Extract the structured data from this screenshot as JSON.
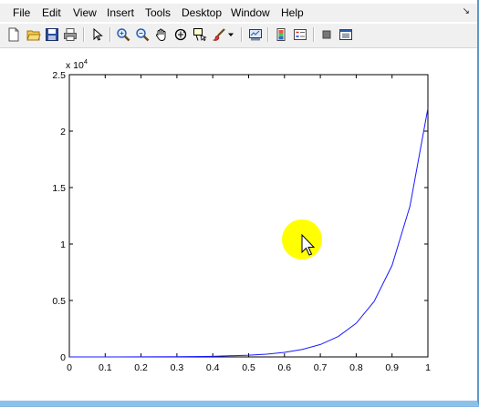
{
  "menubar": {
    "items": [
      "File",
      "Edit",
      "View",
      "Insert",
      "Tools",
      "Desktop",
      "Window",
      "Help"
    ],
    "dock_glyph": "↘"
  },
  "toolbar": {
    "buttons": [
      {
        "name": "new-figure-icon"
      },
      {
        "name": "open-file-icon"
      },
      {
        "name": "save-figure-icon"
      },
      {
        "name": "print-figure-icon"
      },
      {
        "name": "edit-plot-arrow-icon"
      },
      {
        "name": "zoom-in-icon"
      },
      {
        "name": "zoom-out-icon"
      },
      {
        "name": "pan-hand-icon"
      },
      {
        "name": "rotate-3d-icon"
      },
      {
        "name": "data-cursor-icon"
      },
      {
        "name": "brush-icon"
      },
      {
        "name": "brush-dropdown-icon"
      },
      {
        "name": "link-plot-icon"
      },
      {
        "name": "insert-colorbar-icon"
      },
      {
        "name": "insert-legend-icon"
      },
      {
        "name": "hide-plot-tools-icon"
      },
      {
        "name": "show-plot-tools-icon"
      }
    ]
  },
  "chart_data": {
    "type": "line",
    "exponent_label": "x 10",
    "exponent_power": "4",
    "x": [
      0,
      0.1,
      0.2,
      0.3,
      0.4,
      0.5,
      0.55,
      0.6,
      0.65,
      0.7,
      0.75,
      0.8,
      0.85,
      0.9,
      0.95,
      1.0
    ],
    "y": [
      1,
      2.7,
      7.4,
      20.1,
      54.6,
      148,
      245,
      403,
      665,
      1097,
      1808,
      2981,
      4915,
      8103,
      13360,
      22026
    ],
    "xlim": [
      0,
      1
    ],
    "ylim": [
      0,
      25000
    ],
    "xticks": [
      "0",
      "0.1",
      "0.2",
      "0.3",
      "0.4",
      "0.5",
      "0.6",
      "0.7",
      "0.8",
      "0.9",
      "1"
    ],
    "yticks": [
      "0",
      "0.5",
      "1",
      "1.5",
      "2",
      "2.5"
    ],
    "ytick_values": [
      0,
      5000,
      10000,
      15000,
      20000,
      25000
    ],
    "line_color": "#1a1aff",
    "grid": false
  },
  "cursor_highlight": {
    "color": "#ffff00"
  }
}
